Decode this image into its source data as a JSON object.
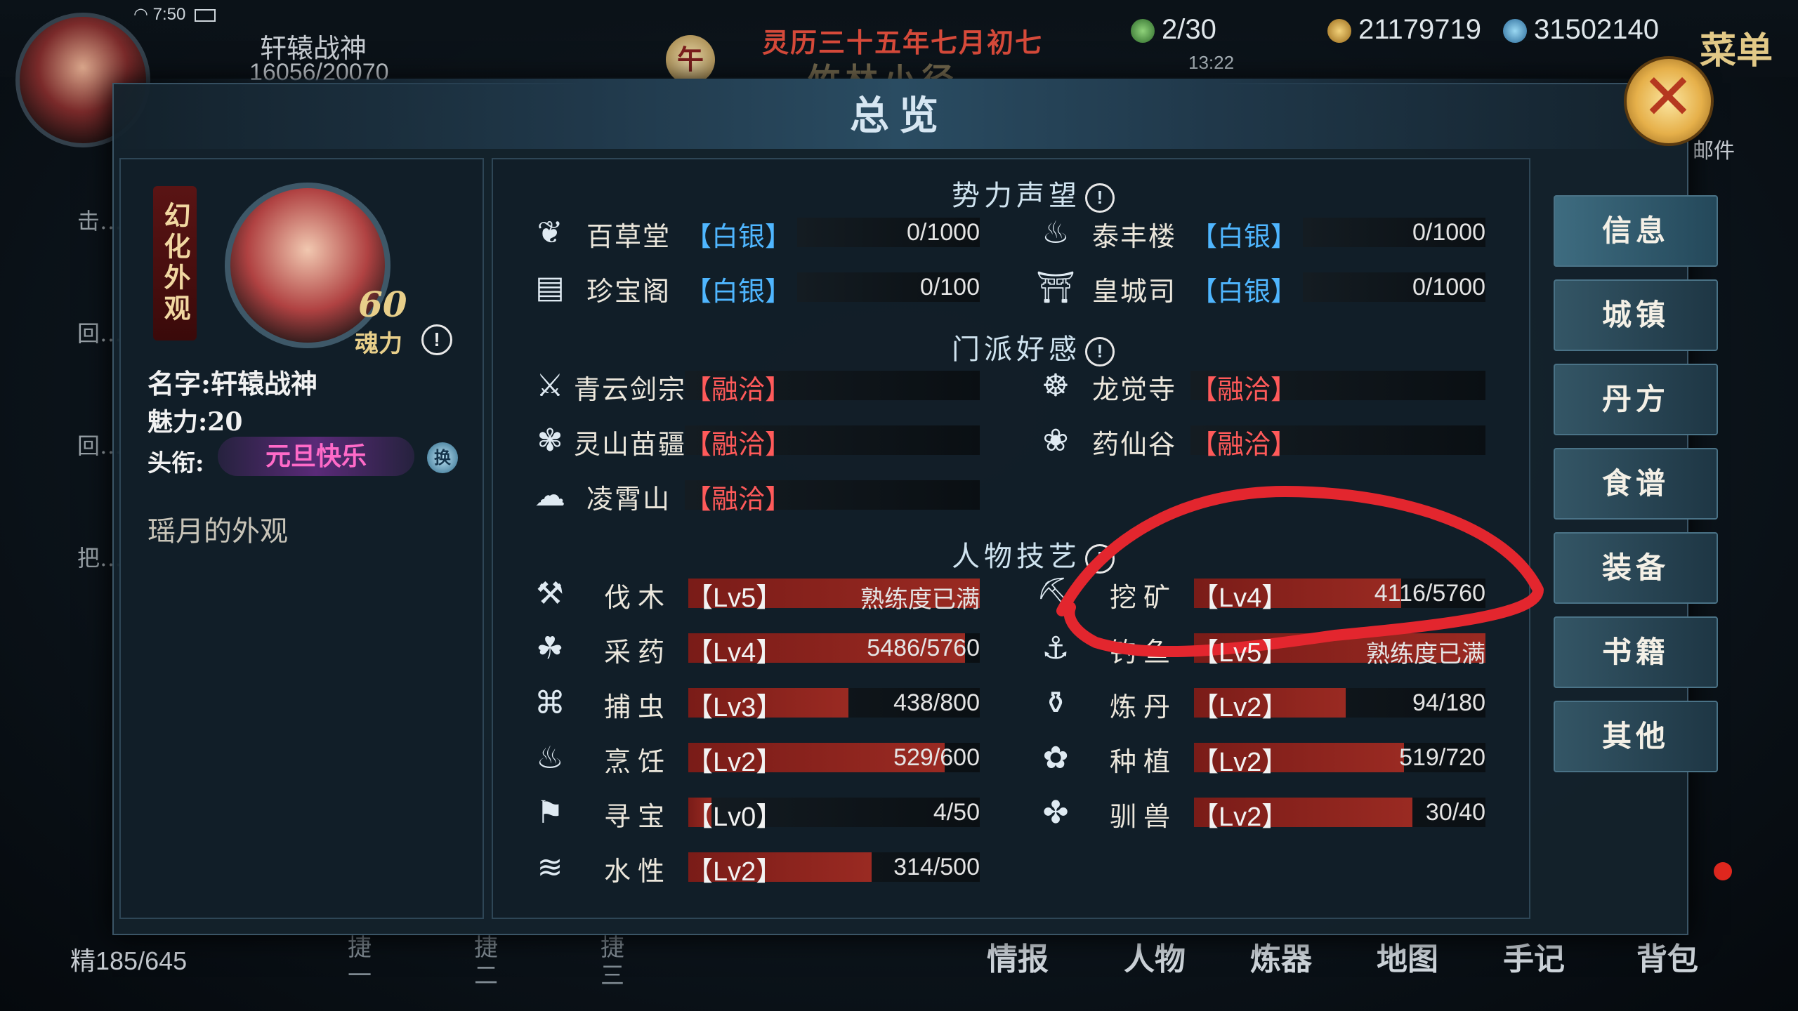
{
  "status_bar": {
    "time": "7:50"
  },
  "player": {
    "name": "轩辕战神",
    "hp": "16056/20070"
  },
  "header": {
    "date_badge": "午",
    "date": "灵历三十五年七月初七",
    "location": "竹林小径",
    "stamina": "2/30",
    "clock": "13:22",
    "copper": "21179719",
    "jade": "31502140",
    "menu_label": "菜单",
    "mail_label": "邮件"
  },
  "side_quests": [
    "击…",
    "回…",
    "回…",
    "把…"
  ],
  "bottom": {
    "energy": "精185/645",
    "hotkeys": [
      "捷一",
      "捷二",
      "捷三"
    ],
    "nav": [
      "情报",
      "人物",
      "炼器",
      "地图",
      "手记",
      "背包"
    ]
  },
  "dialog": {
    "title": "总览",
    "character": {
      "appearance_tag": "幻化外观",
      "level": "60",
      "soul_power_label": "魂力",
      "name_line": "名字:轩辕战神",
      "charm_line": "魅力:20",
      "title_label": "头衔:",
      "title_value": "元旦快乐",
      "swap_label": "换",
      "appearance_desc": "瑶月的外观"
    },
    "sections": {
      "reputation": "势力声望",
      "sect": "门派好感",
      "skills": "人物技艺"
    },
    "reputation": [
      {
        "name": "百草堂",
        "rank": "【白银】",
        "value": "0/1000",
        "icon": "leaf-icon",
        "progress": 0
      },
      {
        "name": "泰丰楼",
        "rank": "【白银】",
        "value": "0/1000",
        "icon": "food-bowl-icon",
        "progress": 0
      },
      {
        "name": "珍宝阁",
        "rank": "【白银】",
        "value": "0/100",
        "icon": "treasure-chest-icon",
        "progress": 0
      },
      {
        "name": "皇城司",
        "rank": "【白银】",
        "value": "0/1000",
        "icon": "gate-icon",
        "progress": 0
      }
    ],
    "sect_favor": [
      {
        "name": "青云剑宗",
        "rank": "【融洽】",
        "icon": "sword-icon"
      },
      {
        "name": "龙觉寺",
        "rank": "【融洽】",
        "icon": "buddha-icon"
      },
      {
        "name": "灵山苗疆",
        "rank": "【融洽】",
        "icon": "butterfly-icon"
      },
      {
        "name": "药仙谷",
        "rank": "【融洽】",
        "icon": "lotus-icon"
      },
      {
        "name": "凌霄山",
        "rank": "【融洽】",
        "icon": "cloud-icon"
      }
    ],
    "skills": [
      {
        "name": "伐木",
        "level": "【Lv5】",
        "value": "熟练度已满",
        "progress": 1.0,
        "icon": "axe-icon"
      },
      {
        "name": "挖矿",
        "level": "【Lv4】",
        "value": "4116/5760",
        "progress": 0.71,
        "icon": "pickaxe-icon"
      },
      {
        "name": "采药",
        "level": "【Lv4】",
        "value": "5486/5760",
        "progress": 0.95,
        "icon": "herb-icon"
      },
      {
        "name": "钓鱼",
        "level": "【Lv5】",
        "value": "熟练度已满",
        "progress": 1.0,
        "icon": "fishing-rod-icon"
      },
      {
        "name": "捕虫",
        "level": "【Lv3】",
        "value": "438/800",
        "progress": 0.55,
        "icon": "net-icon"
      },
      {
        "name": "炼丹",
        "level": "【Lv2】",
        "value": "94/180",
        "progress": 0.52,
        "icon": "cauldron-icon"
      },
      {
        "name": "烹饪",
        "level": "【Lv2】",
        "value": "529/600",
        "progress": 0.88,
        "icon": "cooking-pot-icon"
      },
      {
        "name": "种植",
        "level": "【Lv2】",
        "value": "519/720",
        "progress": 0.72,
        "icon": "sprout-icon"
      },
      {
        "name": "寻宝",
        "level": "【Lv0】",
        "value": "4/50",
        "progress": 0.08,
        "icon": "shovel-icon"
      },
      {
        "name": "驯兽",
        "level": "【Lv2】",
        "value": "30/40",
        "progress": 0.75,
        "icon": "paw-icon"
      },
      {
        "name": "水性",
        "level": "【Lv2】",
        "value": "314/500",
        "progress": 0.63,
        "icon": "wave-icon"
      }
    ]
  },
  "tabs": [
    "信息",
    "城镇",
    "丹方",
    "食谱",
    "装备",
    "书籍",
    "其他"
  ],
  "colors": {
    "rank_blue": "#4fb6ff",
    "rank_red": "#ff5a5a",
    "bar_red": "#8a2420",
    "title_pink": "#ff6ac8",
    "annotation_red": "#e3262e"
  }
}
